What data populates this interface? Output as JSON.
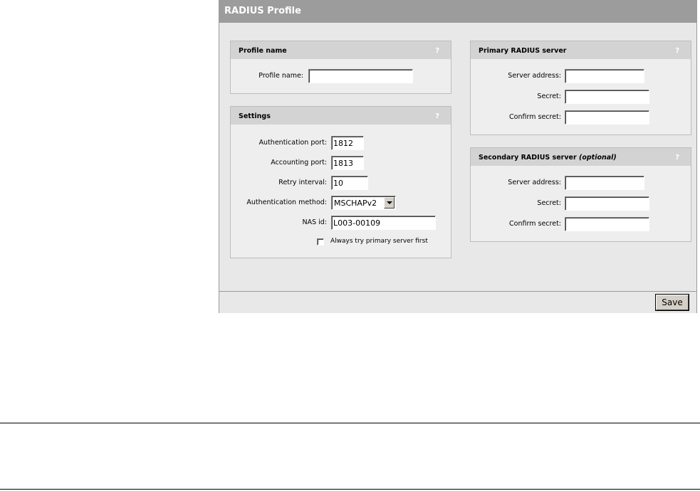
{
  "window": {
    "title": "RADIUS Profile"
  },
  "profile_panel": {
    "header": "Profile name",
    "help": "?",
    "profile_name_label": "Profile name:",
    "profile_name_value": ""
  },
  "settings_panel": {
    "header": "Settings",
    "help": "?",
    "auth_port_label": "Authentication port:",
    "auth_port_value": "1812",
    "acct_port_label": "Accounting port:",
    "acct_port_value": "1813",
    "retry_label": "Retry interval:",
    "retry_value": "10",
    "auth_method_label": "Authentication method:",
    "auth_method_value": "MSCHAPv2",
    "nas_id_label": "NAS id:",
    "nas_id_value": "L003-00109",
    "always_primary_label": "Always try primary server first",
    "always_primary_checked": false
  },
  "primary_panel": {
    "header": "Primary RADIUS server",
    "help": "?",
    "server_address_label": "Server address:",
    "secret_label": "Secret:",
    "confirm_secret_label": "Confirm secret:"
  },
  "secondary_panel": {
    "header": "Secondary RADIUS server",
    "header_optional": "(optional)",
    "help": "?",
    "server_address_label": "Server address:",
    "secret_label": "Secret:",
    "confirm_secret_label": "Confirm secret:"
  },
  "footer": {
    "save_label": "Save"
  }
}
